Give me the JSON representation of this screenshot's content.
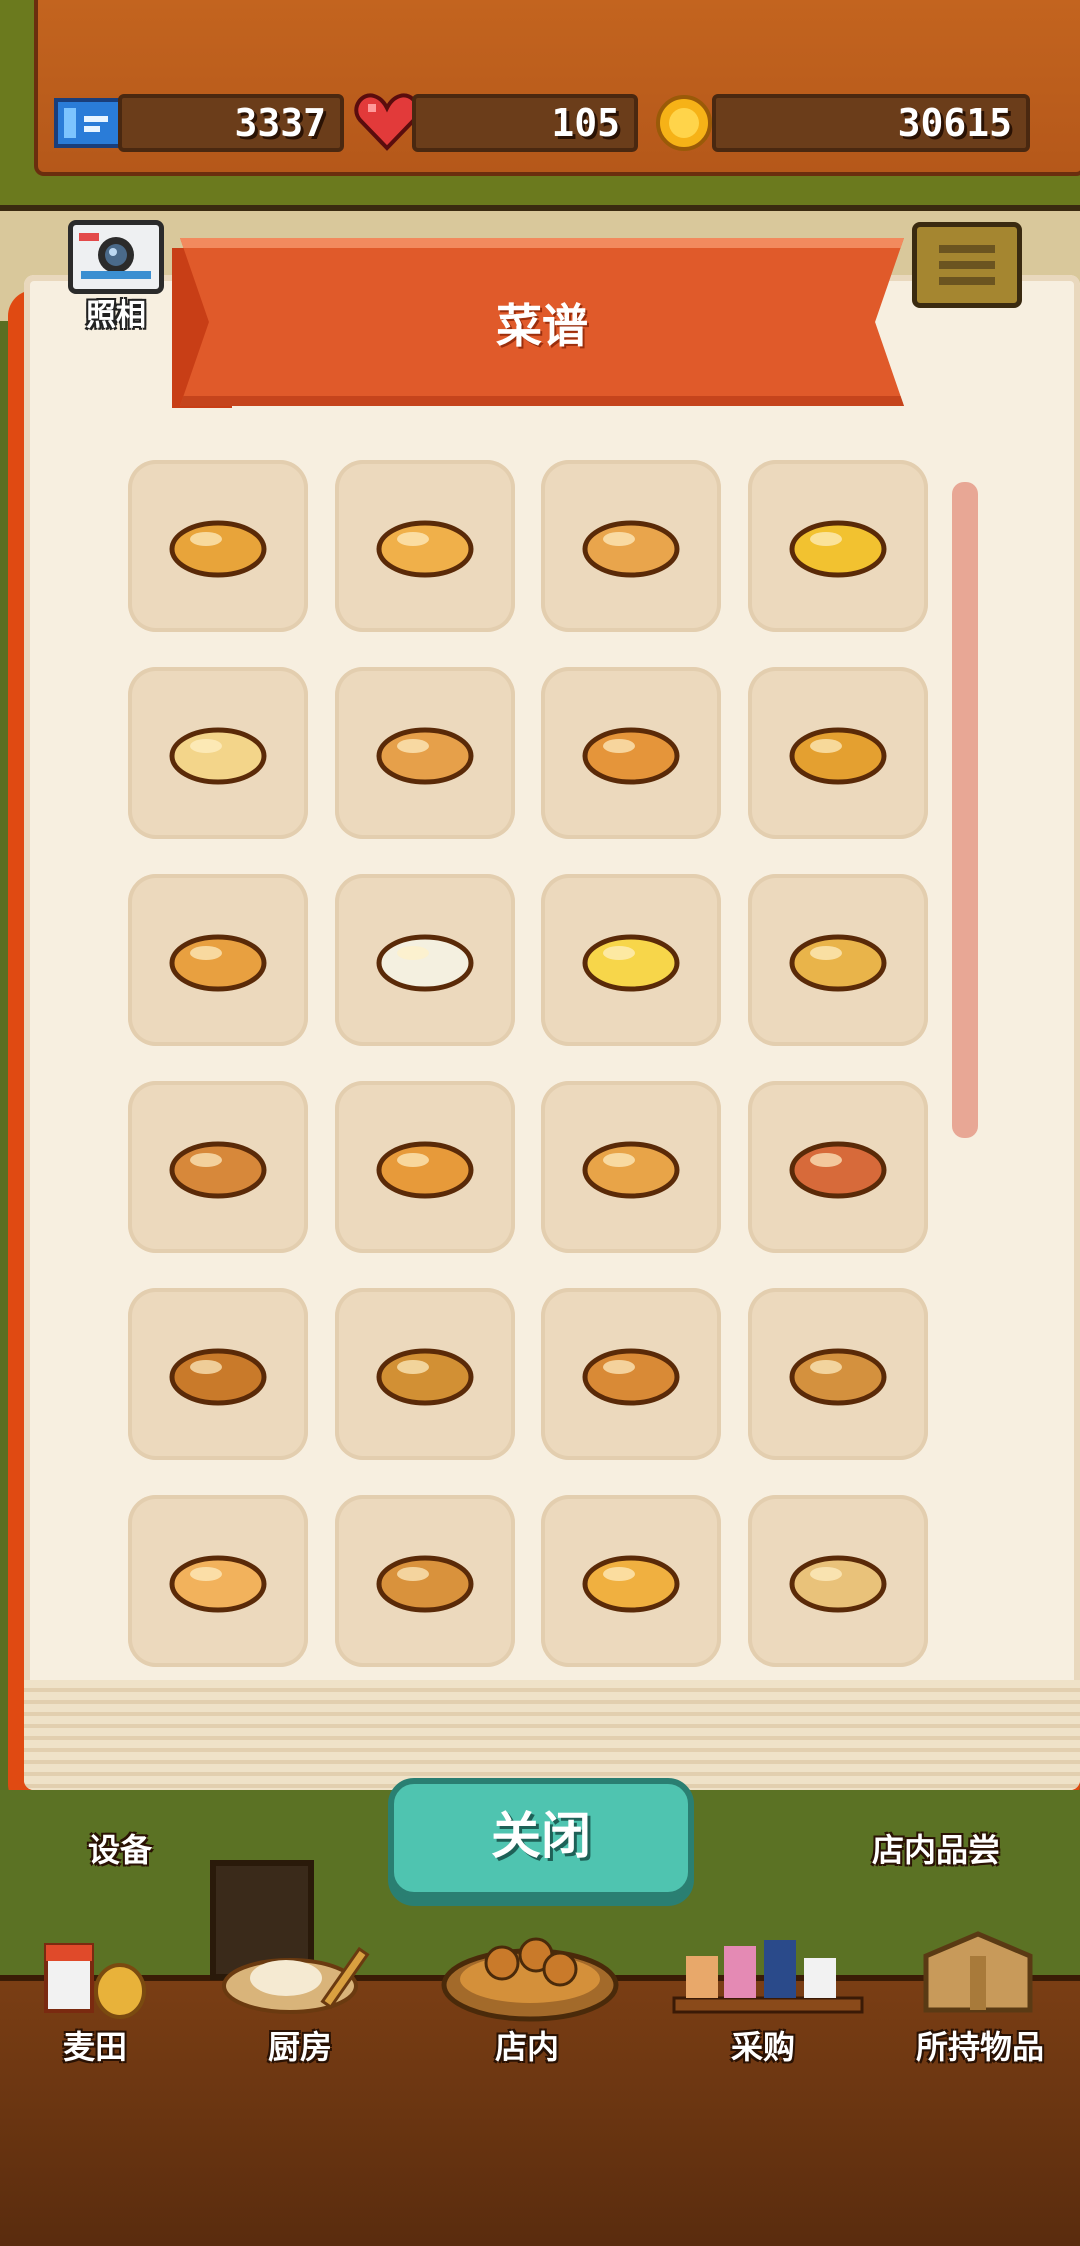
{
  "currency": {
    "tickets": "3337",
    "hearts": "105",
    "coins": "30615"
  },
  "header": {
    "camera_label": "照相"
  },
  "recipe_book": {
    "title": "菜谱",
    "items": [
      {
        "icon": "small-bun-icon"
      },
      {
        "icon": "round-bread-icon"
      },
      {
        "icon": "loaf-bread-icon"
      },
      {
        "icon": "egg-toast-icon"
      },
      {
        "icon": "bagel-icon"
      },
      {
        "icon": "donut-icon"
      },
      {
        "icon": "croissant-icon"
      },
      {
        "icon": "pastry-icon"
      },
      {
        "icon": "bunny-bread-icon"
      },
      {
        "icon": "sandwich-icon"
      },
      {
        "icon": "melon-bun-icon"
      },
      {
        "icon": "baguette-icon"
      },
      {
        "icon": "sprinkle-donut-icon"
      },
      {
        "icon": "pretzel-stick-icon"
      },
      {
        "icon": "french-loaf-icon"
      },
      {
        "icon": "jam-pastry-icon"
      },
      {
        "icon": "chocolate-cornet-icon"
      },
      {
        "icon": "herb-bread-icon"
      },
      {
        "icon": "bear-bread-icon"
      },
      {
        "icon": "sausage-roll-icon"
      },
      {
        "icon": "cream-cake-icon"
      },
      {
        "icon": "pizza-bread-icon"
      },
      {
        "icon": "cheese-croissant-icon"
      },
      {
        "icon": "burger-icon"
      }
    ],
    "close_label": "关闭"
  },
  "side_labels": {
    "equipment": "设备",
    "tasting": "店内品尝"
  },
  "bottom_nav": [
    {
      "label": "麦田"
    },
    {
      "label": "厨房"
    },
    {
      "label": "店内"
    },
    {
      "label": "采购"
    },
    {
      "label": "所持物品"
    }
  ],
  "colors": {
    "wood": "#c3641f",
    "book_cover": "#e04a12",
    "ribbon": "#e05a2a",
    "page": "#f7efe0",
    "cell": "#ecd9bd",
    "close_button": "#4fc4b0"
  }
}
